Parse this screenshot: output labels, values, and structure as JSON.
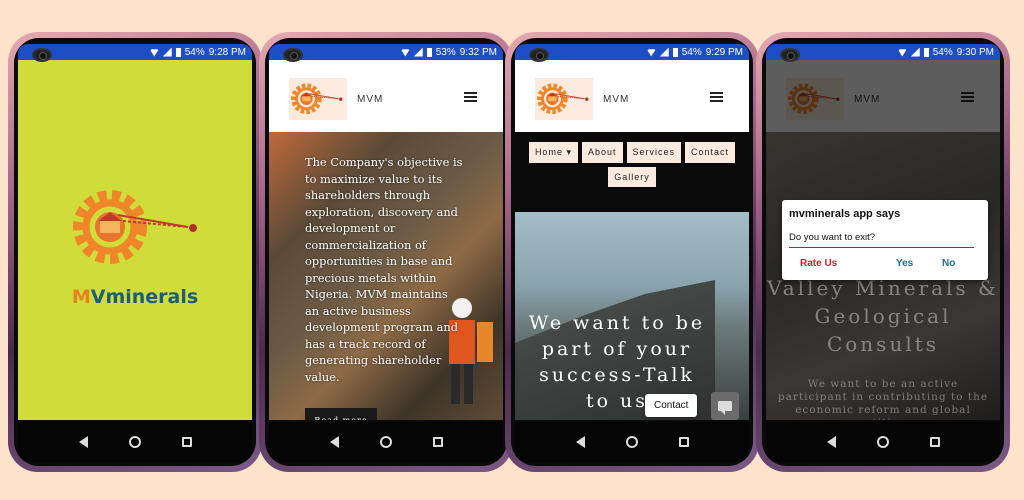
{
  "statusbars": [
    {
      "battery": "54%",
      "time": "9:28 PM"
    },
    {
      "battery": "53%",
      "time": "9:32 PM"
    },
    {
      "battery": "54%",
      "time": "9:29 PM"
    },
    {
      "battery": "54%",
      "time": "9:30 PM"
    }
  ],
  "splash": {
    "brand_m": "M",
    "brand_rest": "Vminerals"
  },
  "header": {
    "name": "MVM"
  },
  "about_screen": {
    "text": "The Company's objective is to maximize value to its shareholders through exploration, discovery and development or commercialization of opportunities in base and precious metals within Nigeria. MVM maintains an active business development program and has a track record of generating shareholder value.",
    "read_more": "Read more"
  },
  "menu_screen": {
    "menu": [
      "Home ▾",
      "About",
      "Services",
      "Contact",
      "Gallery"
    ],
    "hero_text": "We want to be part of your success-Talk to us",
    "contact_popup": "Contact"
  },
  "exit_screen": {
    "hero_title": "Valley Minerals & Geological Consults",
    "hero_sub": "We want to be an active participant in contributing to the economic reform and global competitiveness",
    "dialog": {
      "title": "mvminerals app says",
      "message": "Do you want to exit?",
      "rate": "Rate Us",
      "yes": "Yes",
      "no": "No"
    }
  },
  "colors": {
    "splash_bg": "#cfdc3a",
    "statusbar": "#1d4ec5",
    "page_bg": "#fde3cc",
    "gear": "#f0862a"
  }
}
